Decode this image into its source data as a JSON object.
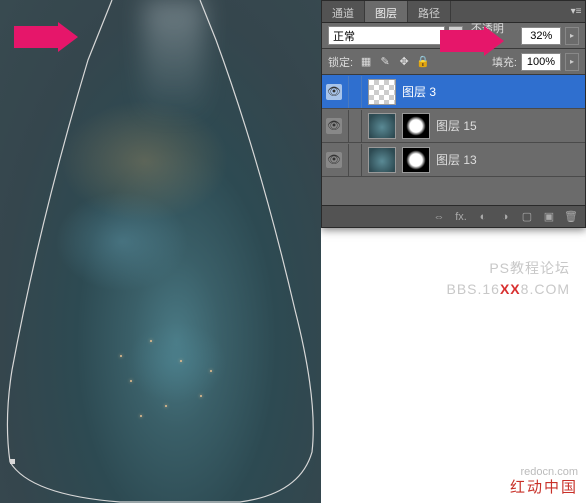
{
  "tabs": {
    "channels": "通道",
    "layers": "图层",
    "paths": "路径"
  },
  "blend": {
    "mode": "正常",
    "opacity_label": "不透明度:",
    "opacity_value": "32%",
    "fill_label": "填充:",
    "fill_value": "100%",
    "lock_label": "锁定:"
  },
  "layer_items": [
    {
      "name": "图层 3"
    },
    {
      "name": "图层 15"
    },
    {
      "name": "图层 13"
    }
  ],
  "foot_icons": {
    "link": "⇔",
    "fx": "fx.",
    "mask": "◐",
    "adjust": "◑",
    "group": "▢",
    "new": "▣",
    "trash": "🗑"
  },
  "watermark": {
    "line1": "PS教程论坛",
    "line2a": "BBS.16",
    "line2b": "XX",
    "line2c": "8.COM"
  },
  "watermark2": {
    "url": "redocn.com",
    "brand": "红动中国"
  }
}
